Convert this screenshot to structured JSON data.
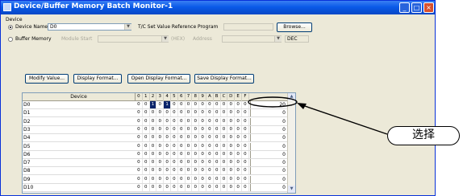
{
  "window": {
    "title": "Device/Buffer Memory Batch Monitor-1",
    "minimize_glyph": "_",
    "maximize_glyph": "□",
    "close_glyph": "×"
  },
  "device_group": {
    "label": "Device",
    "device_name_label": "Device Name",
    "device_name_value": "D0",
    "ts_label": "T/C Set Value Reference Program",
    "ts_value": "",
    "browse_label": "Browse...",
    "buffer_memory_label": "Buffer Memory",
    "module_start_label": "Module Start",
    "hex_label": "(HEX)",
    "address_label": "Address",
    "dec_label": "DEC"
  },
  "buttons": {
    "modify_value": "Modify Value...",
    "display_format": "Display Format...",
    "open_display_format": "Open Display Format...",
    "save_display_format": "Save Display Format..."
  },
  "table": {
    "device_header": "Device",
    "bit_headers": [
      "0",
      "1",
      "2",
      "3",
      "4",
      "5",
      "6",
      "7",
      "8",
      "9",
      "A",
      "B",
      "C",
      "D",
      "E",
      "F"
    ],
    "rows": [
      {
        "device": "D0",
        "bits": [
          "0",
          "0",
          "1",
          "0",
          "1",
          "0",
          "0",
          "0",
          "0",
          "0",
          "0",
          "0",
          "0",
          "0",
          "0",
          "0"
        ],
        "value": "20",
        "highlight": [
          2,
          4
        ]
      },
      {
        "device": "D1",
        "bits": [
          "0",
          "0",
          "0",
          "0",
          "0",
          "0",
          "0",
          "0",
          "0",
          "0",
          "0",
          "0",
          "0",
          "0",
          "0",
          "0"
        ],
        "value": "0"
      },
      {
        "device": "D2",
        "bits": [
          "0",
          "0",
          "0",
          "0",
          "0",
          "0",
          "0",
          "0",
          "0",
          "0",
          "0",
          "0",
          "0",
          "0",
          "0",
          "0"
        ],
        "value": "0"
      },
      {
        "device": "D3",
        "bits": [
          "0",
          "0",
          "0",
          "0",
          "0",
          "0",
          "0",
          "0",
          "0",
          "0",
          "0",
          "0",
          "0",
          "0",
          "0",
          "0"
        ],
        "value": "0"
      },
      {
        "device": "D4",
        "bits": [
          "0",
          "0",
          "0",
          "0",
          "0",
          "0",
          "0",
          "0",
          "0",
          "0",
          "0",
          "0",
          "0",
          "0",
          "0",
          "0"
        ],
        "value": "0"
      },
      {
        "device": "D5",
        "bits": [
          "0",
          "0",
          "0",
          "0",
          "0",
          "0",
          "0",
          "0",
          "0",
          "0",
          "0",
          "0",
          "0",
          "0",
          "0",
          "0"
        ],
        "value": "0"
      },
      {
        "device": "D6",
        "bits": [
          "0",
          "0",
          "0",
          "0",
          "0",
          "0",
          "0",
          "0",
          "0",
          "0",
          "0",
          "0",
          "0",
          "0",
          "0",
          "0"
        ],
        "value": "0"
      },
      {
        "device": "D7",
        "bits": [
          "0",
          "0",
          "0",
          "0",
          "0",
          "0",
          "0",
          "0",
          "0",
          "0",
          "0",
          "0",
          "0",
          "0",
          "0",
          "0"
        ],
        "value": "0"
      },
      {
        "device": "D8",
        "bits": [
          "0",
          "0",
          "0",
          "0",
          "0",
          "0",
          "0",
          "0",
          "0",
          "0",
          "0",
          "0",
          "0",
          "0",
          "0",
          "0"
        ],
        "value": "0"
      },
      {
        "device": "D9",
        "bits": [
          "0",
          "0",
          "0",
          "0",
          "0",
          "0",
          "0",
          "0",
          "0",
          "0",
          "0",
          "0",
          "0",
          "0",
          "0",
          "0"
        ],
        "value": "0"
      },
      {
        "device": "D10",
        "bits": [
          "0",
          "0",
          "0",
          "0",
          "0",
          "0",
          "0",
          "0",
          "0",
          "0",
          "0",
          "0",
          "0",
          "0",
          "0",
          "0"
        ],
        "value": "0"
      }
    ]
  },
  "annotation": {
    "callout_text": "选择"
  },
  "icons": {
    "app": "app-icon",
    "dropdown": "chevron-down-icon",
    "scroll_up": "scroll-up-icon",
    "scroll_down": "scroll-down-icon"
  }
}
